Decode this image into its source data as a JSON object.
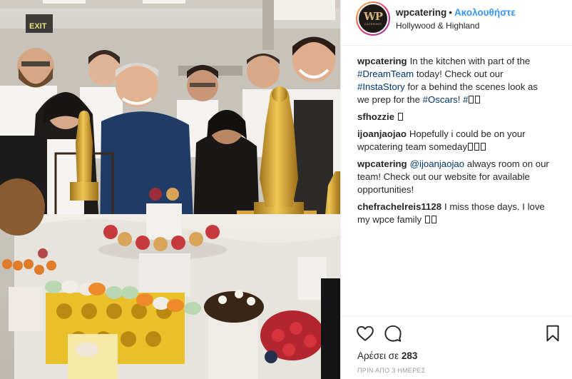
{
  "colors": {
    "link_blue": "#3897f0",
    "hashtag_blue": "#003569",
    "text": "#262626",
    "muted": "#999999",
    "divider": "#efefef"
  },
  "photo": {
    "exit_sign": "EXIT",
    "description_icon": "kitchen-team-photo"
  },
  "header": {
    "username": "wpcatering",
    "separator": "•",
    "follow_label": "Ακολουθήστε",
    "location": "Hollywood & Highland",
    "avatar_monogram": "WP",
    "avatar_word": "CATERING"
  },
  "caption": {
    "username": "wpcatering",
    "text1": "In the kitchen with part of the ",
    "tag1": "#DreamTeam",
    "text2": " today! Check out our ",
    "tag2": "#InstaStory",
    "text3": " for a behind the scenes look as we prep for the ",
    "tag3": "#Oscars",
    "text4": "! ",
    "tag4": "#"
  },
  "comments": [
    {
      "username": "sfhozzie",
      "text": ""
    },
    {
      "username": "ijoanjaojao",
      "text": "Hopefully i could be on your wpcatering team someday"
    },
    {
      "username": "wpcatering",
      "mention": "@ijoanjaojao",
      "text": " always room on our team! Check out our website for available opportunities!"
    },
    {
      "username": "chefrachelreis1128",
      "text": "I miss those days. I love my wpce family "
    }
  ],
  "actions": {
    "like_icon": "heart-icon",
    "comment_icon": "comment-bubble-icon",
    "save_icon": "bookmark-icon"
  },
  "likes": {
    "label": "Αρέσει σε ",
    "count": "283"
  },
  "timestamp": "ΠΡΙΝ ΑΠΟ 3 ΗΜΕΡΕΣ"
}
